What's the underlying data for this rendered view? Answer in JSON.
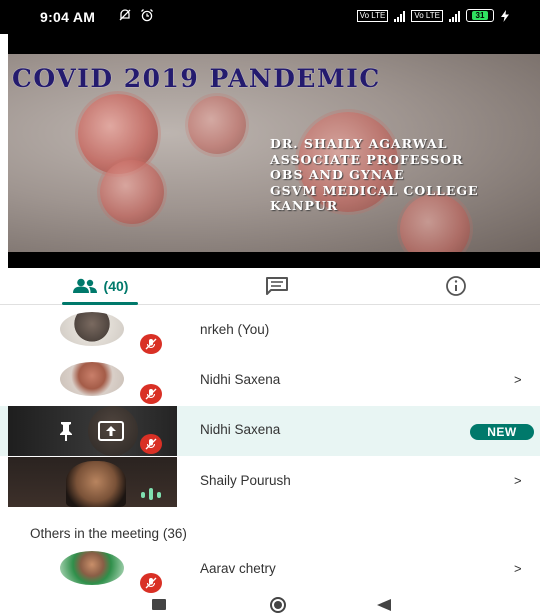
{
  "status_bar": {
    "time": "9:04 AM",
    "net_chip_1": "Vo LTE",
    "net_chip_2": "Vo LTE",
    "battery": "31",
    "icons": [
      "alarm-off-icon",
      "alarm-icon",
      "signal-icon",
      "battery-icon",
      "charging-icon"
    ]
  },
  "video": {
    "slide_title": "COVID 2019 PANDEMIC",
    "presenter_lines": [
      "DR. SHAILY AGARWAL",
      "ASSOCIATE PROFESSOR",
      "OBS AND GYNAE",
      "GSVM MEDICAL COLLEGE",
      "KANPUR"
    ]
  },
  "tabs": {
    "people_count": "(40)",
    "active": "people",
    "icons": [
      "people-icon",
      "chat-icon",
      "info-icon"
    ]
  },
  "participants": [
    {
      "name": "nrkeh (You)",
      "chevron": ""
    },
    {
      "name": "Nidhi Saxena",
      "chevron": ">"
    },
    {
      "name": "Nidhi Saxena",
      "badge": "NEW"
    },
    {
      "name": "Shaily Pourush",
      "chevron": ">"
    }
  ],
  "others_header": "Others in the meeting (36)",
  "others": [
    {
      "name": "Aarav chetry",
      "chevron": ">"
    }
  ],
  "colors": {
    "accent": "#00796b",
    "mute_red": "#d93025",
    "highlight_row": "#e8f5f3"
  }
}
